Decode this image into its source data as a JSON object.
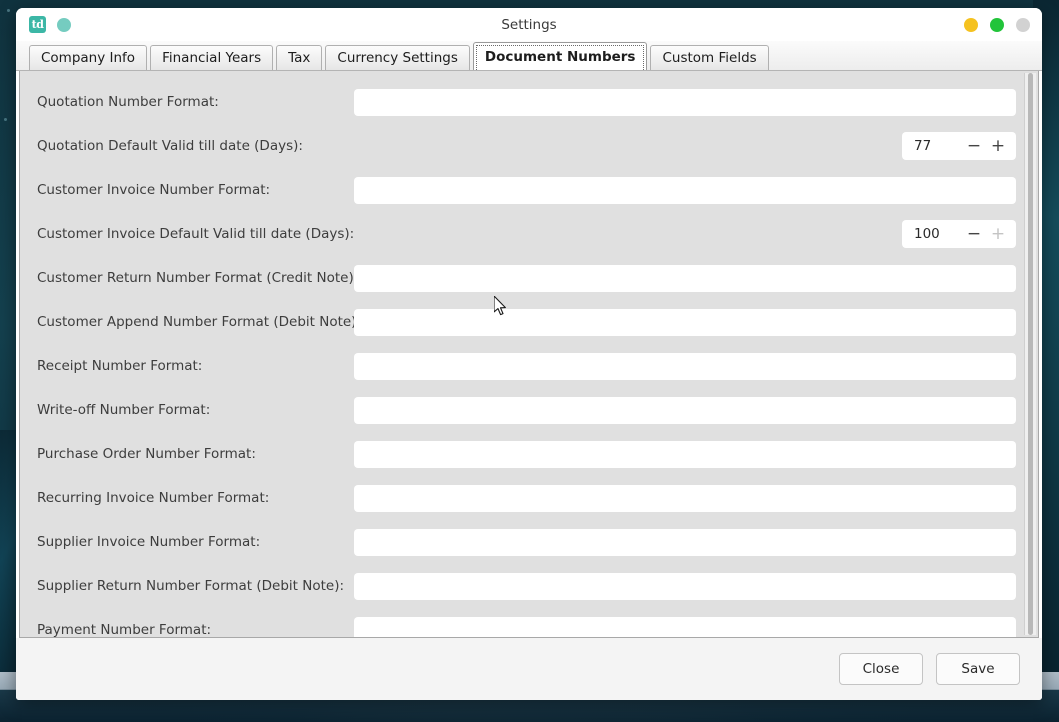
{
  "window": {
    "title": "Settings",
    "app_icon": "td",
    "app_icon_label": "td-app-icon",
    "controls": [
      {
        "name": "minimize",
        "color": "#f5c220"
      },
      {
        "name": "maximize",
        "color": "#22c43a"
      },
      {
        "name": "close",
        "color": "#d2d2d2"
      }
    ]
  },
  "tabs": [
    {
      "label": "Company Info",
      "active": false
    },
    {
      "label": "Financial Years",
      "active": false
    },
    {
      "label": "Tax",
      "active": false
    },
    {
      "label": "Currency Settings",
      "active": false
    },
    {
      "label": "Document Numbers",
      "active": true
    },
    {
      "label": "Custom Fields",
      "active": false
    }
  ],
  "form": {
    "rows": [
      {
        "label": "Quotation Number Format:",
        "type": "text",
        "value": "",
        "placeholder": ""
      },
      {
        "label": "Quotation Default Valid till date (Days):",
        "type": "spinner",
        "value": "77",
        "minus": "−",
        "plus": "+",
        "plus_disabled": false
      },
      {
        "label": "Customer Invoice Number Format:",
        "type": "text",
        "value": "",
        "placeholder": ""
      },
      {
        "label": "Customer Invoice Default Valid till date (Days):",
        "type": "spinner",
        "value": "100",
        "minus": "−",
        "plus": "+",
        "plus_disabled": true
      },
      {
        "label": "Customer Return Number Format (Credit Note):",
        "type": "text",
        "value": "",
        "placeholder": ""
      },
      {
        "label": "Customer Append Number Format (Debit Note):",
        "type": "text",
        "value": "",
        "placeholder": ""
      },
      {
        "label": "Receipt Number Format:",
        "type": "text",
        "value": "",
        "placeholder": ""
      },
      {
        "label": "Write-off Number Format:",
        "type": "text",
        "value": "",
        "placeholder": ""
      },
      {
        "label": "Purchase Order Number Format:",
        "type": "text",
        "value": "",
        "placeholder": ""
      },
      {
        "label": "Recurring Invoice Number Format:",
        "type": "text",
        "value": "",
        "placeholder": ""
      },
      {
        "label": "Supplier Invoice Number Format:",
        "type": "text",
        "value": "",
        "placeholder": ""
      },
      {
        "label": "Supplier Return Number Format (Debit Note):",
        "type": "text",
        "value": "",
        "placeholder": ""
      },
      {
        "label": "Payment Number Format:",
        "type": "text",
        "value": "",
        "placeholder": ""
      }
    ]
  },
  "footer": {
    "close_label": "Close",
    "save_label": "Save"
  },
  "colors": {
    "accent_teal": "#3cb7a6",
    "form_bg": "#e0e0e0",
    "footer_bg": "#f4f4f4",
    "field_bg": "#ffffff"
  }
}
